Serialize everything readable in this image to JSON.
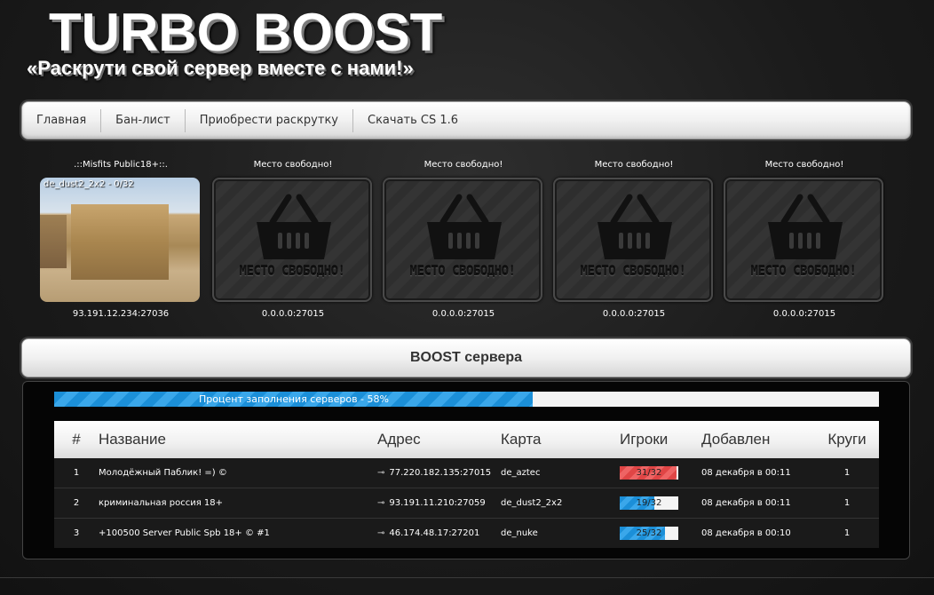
{
  "header": {
    "title": "TURBO BOOST",
    "subtitle": "«Раскрути свой сервер вместе с нами!»"
  },
  "nav": {
    "items": [
      "Главная",
      "Бан-лист",
      "Приобрести раскрутку",
      "Скачать CS 1.6"
    ]
  },
  "slots": [
    {
      "name": ".::Misfits Public18+::.",
      "map_label": "de_dust2_2x2 - 0/32",
      "address": "93.191.12.234:27036"
    },
    {
      "name": "Место свободно!",
      "image_text": "МЕСТО СВОБОДНО!",
      "address": "0.0.0.0:27015"
    },
    {
      "name": "Место свободно!",
      "image_text": "МЕСТО СВОБОДНО!",
      "address": "0.0.0.0:27015"
    },
    {
      "name": "Место свободно!",
      "image_text": "МЕСТО СВОБОДНО!",
      "address": "0.0.0.0:27015"
    },
    {
      "name": "Место свободно!",
      "image_text": "МЕСТО СВОБОДНО!",
      "address": "0.0.0.0:27015"
    }
  ],
  "boost": {
    "title": "BOOST сервера",
    "progress_text": "Процент заполнения серверов - 58%",
    "progress_percent": 58
  },
  "table": {
    "headers": [
      "#",
      "Название",
      "Адрес",
      "Карта",
      "Игроки",
      "Добавлен",
      "Круги"
    ],
    "rows": [
      {
        "num": "1",
        "name": "Молодёжный Паблик! =) ©",
        "address": "77.220.182.135:27015",
        "map": "de_aztec",
        "players": "31/32",
        "players_fraction": 0.97,
        "added": "08 декабря в 00:11",
        "laps": "1"
      },
      {
        "num": "2",
        "name": "криминальная россия 18+",
        "address": "93.191.11.210:27059",
        "map": "de_dust2_2x2",
        "players": "19/32",
        "players_fraction": 0.59,
        "added": "08 декабря в 00:11",
        "laps": "1"
      },
      {
        "num": "3",
        "name": "+100500 Server Public Spb 18+ © #1",
        "address": "46.174.48.17:27201",
        "map": "de_nuke",
        "players": "25/32",
        "players_fraction": 0.78,
        "added": "08 декабря в 00:10",
        "laps": "1"
      }
    ]
  },
  "colors": {
    "progress_blue": "#1b8fd8",
    "players_full_red": "#e04545"
  },
  "icons": {
    "basket": "basket-icon",
    "link": "link-icon"
  }
}
